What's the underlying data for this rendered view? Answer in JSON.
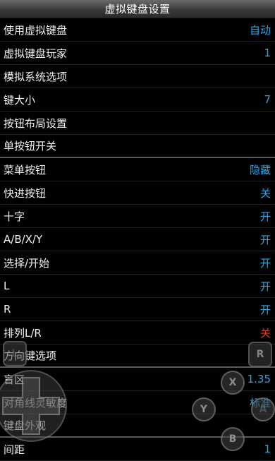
{
  "header": {
    "title": "虚拟键盘设置"
  },
  "settings": [
    {
      "label": "使用虚拟键盘",
      "value": "自动"
    },
    {
      "label": "虚拟键盘玩家",
      "value": "1"
    },
    {
      "label": "模拟系统选项",
      "value": ""
    },
    {
      "label": "键大小",
      "value": "7"
    },
    {
      "label": "按钮布局设置",
      "value": ""
    },
    {
      "label": "单按钮开关",
      "value": ""
    },
    {
      "label": "菜单按钮",
      "value": "隐藏"
    },
    {
      "label": "快进按钮",
      "value": "关"
    },
    {
      "label": "十字",
      "value": "开"
    },
    {
      "label": "A/B/X/Y",
      "value": "开"
    },
    {
      "label": "选择/开始",
      "value": "开"
    },
    {
      "label": "L",
      "value": "开"
    },
    {
      "label": "R",
      "value": "开"
    },
    {
      "label": "排列L/R",
      "value": "关"
    },
    {
      "label": "方向键选项",
      "value": ""
    },
    {
      "label": "盲区",
      "value": "1.35"
    },
    {
      "label": "对角线灵敏度",
      "value": "标准"
    },
    {
      "label": "键盘外观",
      "value": ""
    },
    {
      "label": "间距",
      "value": "1"
    }
  ],
  "overlay": {
    "buttons": {
      "x": "X",
      "y": "Y",
      "b": "B",
      "a": "A",
      "r": "R",
      "l": "L"
    }
  },
  "colors": {
    "accent": "#2aa7e6",
    "off_red": "#e03a2a"
  }
}
